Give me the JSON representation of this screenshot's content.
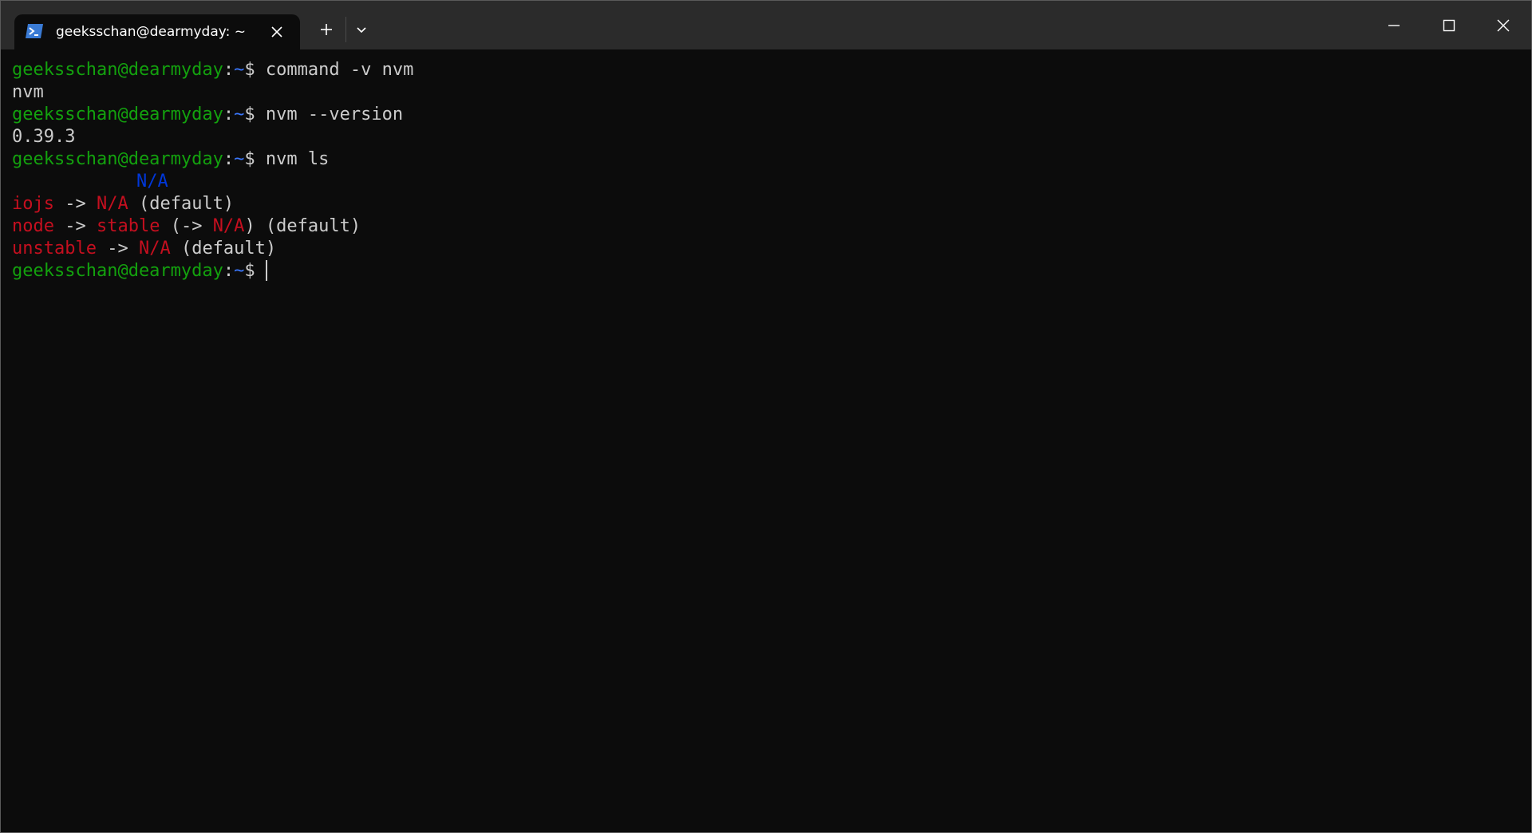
{
  "tab": {
    "title": "geeksschan@dearmyday: ~",
    "icon": "terminal-icon"
  },
  "prompt": {
    "user_host": "geeksschan@dearmyday",
    "colon": ":",
    "path": "~",
    "symbol": "$ "
  },
  "lines": {
    "cmd1": "command -v nvm",
    "out1": "nvm",
    "cmd2": "nvm --version",
    "out2": "0.39.3",
    "cmd3": "nvm ls",
    "ls_current": "N/A",
    "iojs_name": "iojs",
    "iojs_arrow": " -> ",
    "iojs_target": "N/A",
    "iojs_suffix": " (default)",
    "node_name": "node",
    "node_arrow": " -> ",
    "node_target": "stable",
    "node_open": " (-> ",
    "node_na": "N/A",
    "node_suffix": ") (default)",
    "unstable_name": "unstable",
    "unstable_arrow": " -> ",
    "unstable_target": "N/A",
    "unstable_suffix": " (default)"
  },
  "colors": {
    "background": "#0c0c0c",
    "titlebar": "#2b2b2b",
    "prompt_green": "#13a10e",
    "path_blue": "#3b78ff",
    "current_blue": "#0037da",
    "error_red": "#c50f1f",
    "text": "#cccccc"
  }
}
